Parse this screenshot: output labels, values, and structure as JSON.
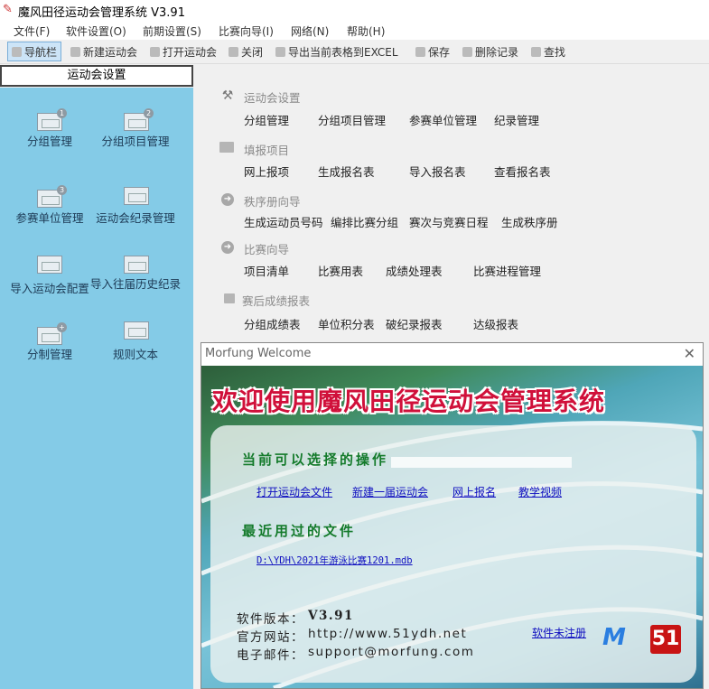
{
  "window": {
    "title": "魔风田径运动会管理系统 V3.91"
  },
  "menu": [
    "文件(F)",
    "软件设置(O)",
    "前期设置(S)",
    "比赛向导(I)",
    "网络(N)",
    "帮助(H)"
  ],
  "toolbar": {
    "nav": "导航栏",
    "new": "新建运动会",
    "open": "打开运动会",
    "close": "关闭",
    "export": "导出当前表格到EXCEL",
    "save": "保存",
    "delete": "删除记录",
    "find": "查找"
  },
  "sidebar": {
    "header": "运动会设置",
    "items": [
      {
        "label": "分组管理",
        "badge": "1"
      },
      {
        "label": "分组项目管理",
        "badge": "2"
      },
      {
        "label": "参赛单位管理",
        "badge": "3"
      },
      {
        "label": "运动会纪录管理",
        "badge": ""
      },
      {
        "label": "导入运动会配置",
        "badge": ""
      },
      {
        "label": "导入往届历史纪录",
        "badge": ""
      },
      {
        "label": "分制管理",
        "badge": "+"
      },
      {
        "label": "规则文本",
        "badge": ""
      }
    ]
  },
  "sections": [
    {
      "title": "运动会设置",
      "items": [
        "分组管理",
        "分组项目管理",
        "参赛单位管理",
        "纪录管理"
      ]
    },
    {
      "title": "填报项目",
      "items": [
        "网上报项",
        "生成报名表",
        "导入报名表",
        "查看报名表"
      ]
    },
    {
      "title": "秩序册向导",
      "items": [
        "生成运动员号码",
        "编排比赛分组",
        "赛次与竞赛日程",
        "生成秩序册"
      ]
    },
    {
      "title": "比赛向导",
      "items": [
        "项目清单",
        "比赛用表",
        "成绩处理表",
        "比赛进程管理"
      ]
    },
    {
      "title": "赛后成绩报表",
      "items": [
        "分组成绩表",
        "单位积分表",
        "破纪录报表",
        "达级报表"
      ]
    }
  ],
  "dialog": {
    "title": "Morfung Welcome",
    "banner": "欢迎使用魔风田径运动会管理系统",
    "ops_heading": "当前可以选择的操作",
    "ops": [
      "打开运动会文件",
      "新建一届运动会",
      "网上报名",
      "教学视频"
    ],
    "recent_heading": "最近用过的文件",
    "recent": [
      "D:\\YDH\\2021年游泳比赛1201.mdb"
    ],
    "version_label": "软件版本：",
    "version": "V3.91",
    "site_label": "官方网站：",
    "site": "http://www.51ydh.net",
    "email_label": "电子邮件：",
    "email": "support@morfung.com",
    "register": "软件未注册",
    "logo_m": "M",
    "logo_51": "51"
  }
}
